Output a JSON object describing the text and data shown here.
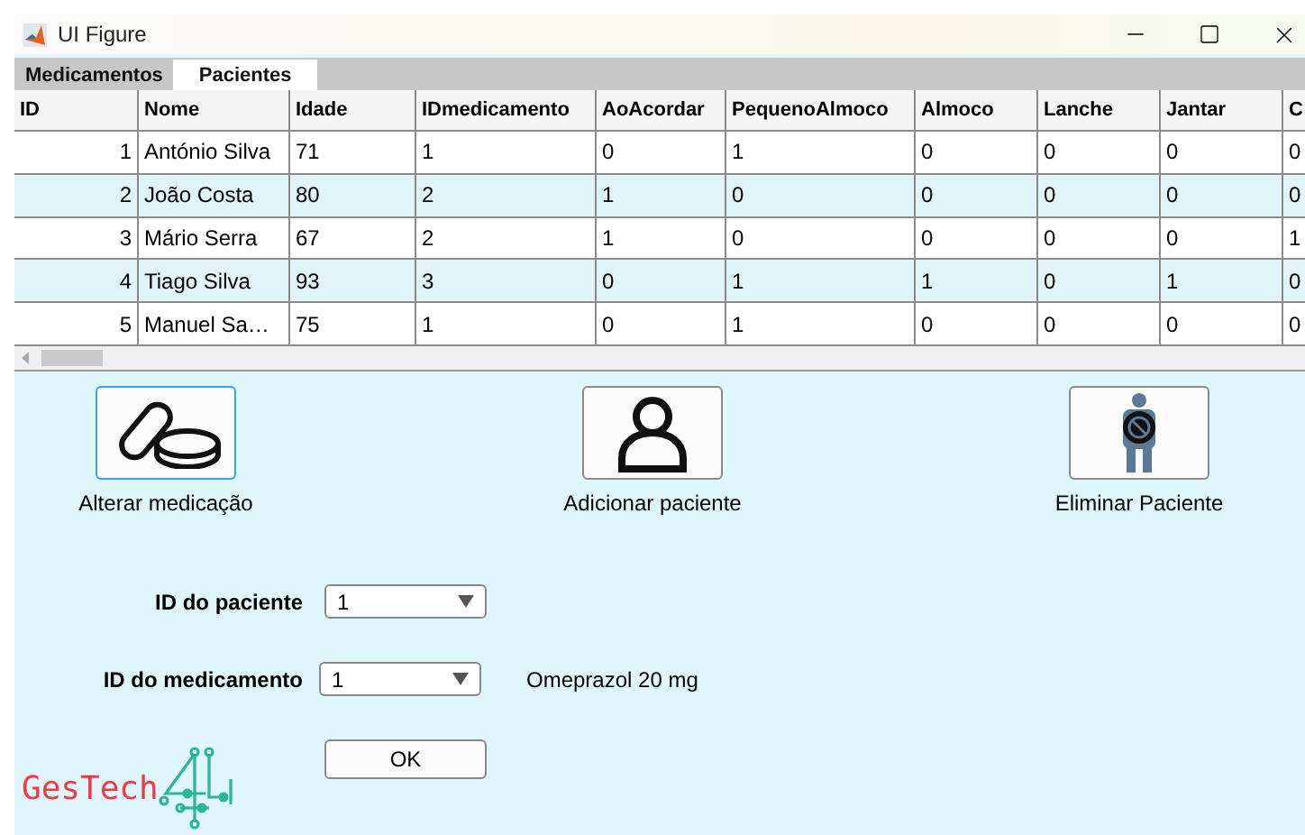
{
  "window": {
    "title": "UI Figure"
  },
  "tabs": [
    {
      "label": "Medicamentos",
      "selected": false
    },
    {
      "label": "Pacientes",
      "selected": true
    }
  ],
  "table": {
    "columns": [
      "ID",
      "Nome",
      "Idade",
      "IDmedicamento",
      "AoAcordar",
      "PequenoAlmoco",
      "Almoco",
      "Lanche",
      "Jantar",
      "C"
    ],
    "rows": [
      [
        "1",
        "António Silva",
        "71",
        "1",
        "0",
        "1",
        "0",
        "0",
        "0",
        "0"
      ],
      [
        "2",
        "João Costa",
        "80",
        "2",
        "1",
        "0",
        "0",
        "0",
        "0",
        "0"
      ],
      [
        "3",
        "Mário Serra",
        "67",
        "2",
        "1",
        "0",
        "0",
        "0",
        "0",
        "1"
      ],
      [
        "4",
        "Tiago Silva",
        "93",
        "3",
        "0",
        "1",
        "1",
        "0",
        "1",
        "0"
      ],
      [
        "5",
        "Manuel Sa…",
        "75",
        "1",
        "0",
        "1",
        "0",
        "0",
        "0",
        "0"
      ]
    ]
  },
  "actions": [
    {
      "kind": "pills",
      "label": "Alterar medicação",
      "focused": true
    },
    {
      "kind": "add-person",
      "label": "Adicionar paciente",
      "focused": false
    },
    {
      "kind": "remove-person",
      "label": "Eliminar Paciente",
      "focused": false
    }
  ],
  "form": {
    "patient": {
      "label": "ID do paciente",
      "value": "1"
    },
    "medication": {
      "label": "ID do medicamento",
      "value": "1",
      "name": "Omeprazol 20 mg"
    },
    "ok": "OK"
  },
  "logo": {
    "text": "GesTech"
  }
}
